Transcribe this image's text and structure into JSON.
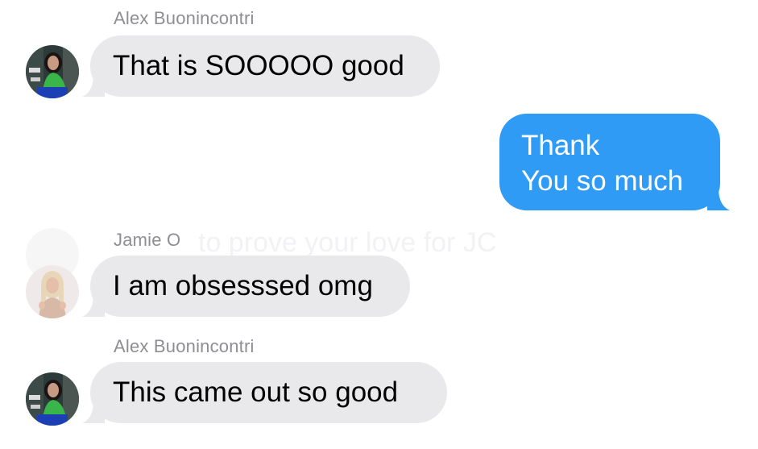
{
  "colors": {
    "incoming_bubble": "#e9e9eb",
    "outgoing_bubble": "#2f9bf4",
    "sender_name": "#8e8e93",
    "background": "#ffffff"
  },
  "messages": [
    {
      "sender": "Alex Buonincontri",
      "text": "That is SOOOOO good",
      "direction": "incoming",
      "avatar": "avatar-alex"
    },
    {
      "lines": [
        "Thank",
        "You so much"
      ],
      "direction": "outgoing"
    },
    {
      "sender": "Jamie O",
      "text": "I am obsesssed omg",
      "direction": "incoming",
      "avatar": "avatar-jamie"
    },
    {
      "sender": "Alex Buonincontri",
      "text": "This came out so good",
      "direction": "incoming",
      "avatar": "avatar-alex"
    }
  ],
  "ghost_overlay": {
    "text": "to prove your love for JC"
  }
}
